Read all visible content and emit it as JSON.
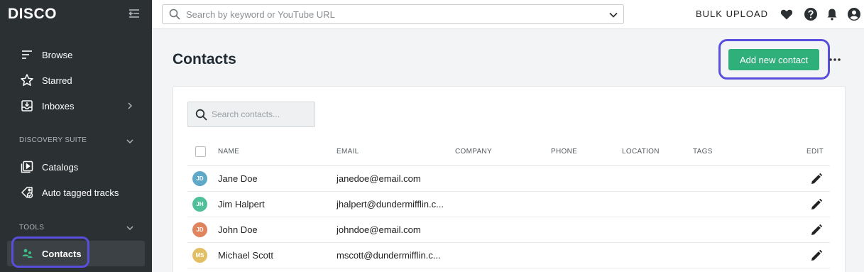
{
  "app": {
    "brand": "DISCO"
  },
  "sidebar": {
    "items": [
      {
        "label": "Browse",
        "icon": "browse-icon"
      },
      {
        "label": "Starred",
        "icon": "star-icon"
      },
      {
        "label": "Inboxes",
        "icon": "inbox-icon"
      }
    ],
    "discovery_suite": {
      "heading": "DISCOVERY SUITE",
      "items": [
        {
          "label": "Catalogs",
          "icon": "catalog-icon"
        },
        {
          "label": "Auto tagged tracks",
          "icon": "auto-tag-icon"
        }
      ]
    },
    "tools": {
      "heading": "TOOLS",
      "items": [
        {
          "label": "Contacts",
          "icon": "contacts-icon",
          "active": true
        }
      ]
    }
  },
  "topbar": {
    "search_placeholder": "Search by keyword or YouTube URL",
    "bulk_upload": "BULK UPLOAD"
  },
  "main": {
    "title": "Contacts",
    "add_button": "Add new contact",
    "search_placeholder": "Search contacts...",
    "columns": [
      "NAME",
      "EMAIL",
      "COMPANY",
      "PHONE",
      "LOCATION",
      "TAGS",
      "EDIT"
    ],
    "rows": [
      {
        "initials": "JD",
        "name": "Jane Doe",
        "email": "janedoe@email.com",
        "color": "#5fa8c8"
      },
      {
        "initials": "JH",
        "name": "Jim Halpert",
        "email": "jhalpert@dundermifflin.c...",
        "color": "#4fc09a"
      },
      {
        "initials": "JD",
        "name": "John Doe",
        "email": "johndoe@email.com",
        "color": "#e0845e"
      },
      {
        "initials": "MS",
        "name": "Michael Scott",
        "email": "mscott@dundermifflin.c...",
        "color": "#e3bf63"
      }
    ]
  },
  "colors": {
    "accent": "#2fb07a",
    "focus_ring": "#5a4fdc",
    "sidebar_bg": "#2b3033"
  }
}
